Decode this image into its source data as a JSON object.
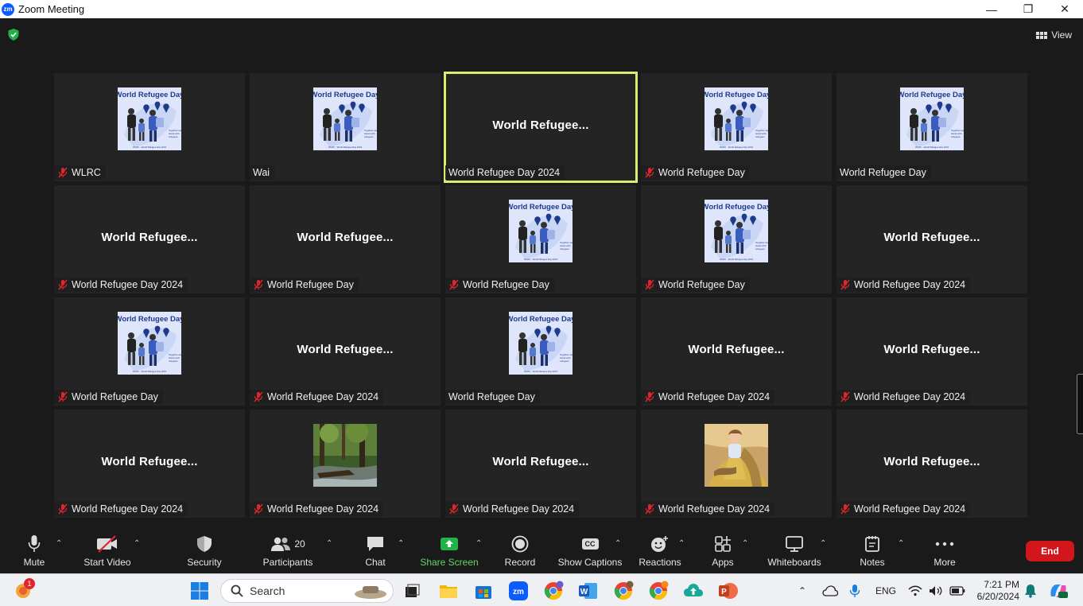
{
  "window": {
    "title": "Zoom Meeting",
    "app_logo": "zm"
  },
  "header": {
    "view_label": "View"
  },
  "tiles": [
    {
      "name": "WLRC",
      "display": "image",
      "muted": true
    },
    {
      "name": "Wai",
      "display": "image",
      "muted": false
    },
    {
      "name": "World Refugee Day 2024",
      "display": "text",
      "big": "World  Refugee...",
      "muted": false,
      "active": true
    },
    {
      "name": "World Refugee Day",
      "display": "image",
      "muted": true
    },
    {
      "name": "World Refugee Day",
      "display": "image",
      "muted": false
    },
    {
      "name": "World Refugee Day 2024",
      "display": "text",
      "big": "World  Refugee...",
      "muted": true
    },
    {
      "name": "World Refugee Day",
      "display": "text",
      "big": "World  Refugee...",
      "muted": true
    },
    {
      "name": "World Refugee Day",
      "display": "image",
      "muted": true
    },
    {
      "name": "World Refugee Day",
      "display": "image",
      "muted": true
    },
    {
      "name": "World Refugee Day 2024",
      "display": "text",
      "big": "World  Refugee...",
      "muted": true
    },
    {
      "name": "World Refugee Day",
      "display": "image",
      "muted": true
    },
    {
      "name": "World Refugee Day 2024",
      "display": "text",
      "big": "World  Refugee...",
      "muted": true
    },
    {
      "name": "World Refugee Day",
      "display": "image",
      "muted": false
    },
    {
      "name": "World Refugee Day 2024",
      "display": "text",
      "big": "World  Refugee...",
      "muted": true
    },
    {
      "name": "World Refugee Day 2024",
      "display": "text",
      "big": "World  Refugee...",
      "muted": true
    },
    {
      "name": "World Refugee Day 2024",
      "display": "text",
      "big": "World  Refugee...",
      "muted": true
    },
    {
      "name": "World Refugee Day 2024",
      "display": "forest",
      "muted": true
    },
    {
      "name": "World Refugee Day 2024",
      "display": "text",
      "big": "World  Refugee...",
      "muted": true
    },
    {
      "name": "World Refugee Day 2024",
      "display": "portrait",
      "muted": true
    },
    {
      "name": "World Refugee Day 2024",
      "display": "text",
      "big": "World  Refugee...",
      "muted": true
    }
  ],
  "toolbar": {
    "mute": "Mute",
    "start_video": "Start Video",
    "security": "Security",
    "participants": "Participants",
    "participants_count": "20",
    "chat": "Chat",
    "share_screen": "Share Screen",
    "record": "Record",
    "show_captions": "Show Captions",
    "captions_icon_text": "CC",
    "reactions": "Reactions",
    "apps": "Apps",
    "whiteboards": "Whiteboards",
    "notes": "Notes",
    "more": "More",
    "end": "End"
  },
  "taskbar": {
    "search_placeholder": "Search",
    "notification_count": "1",
    "language": "ENG",
    "time": "7:21 PM",
    "date": "6/20/2024"
  },
  "colors": {
    "active_speaker": "#d7ee74",
    "end_button": "#d3161b",
    "share_green": "#1fb34a",
    "zoom_blue": "#0b5cff"
  }
}
